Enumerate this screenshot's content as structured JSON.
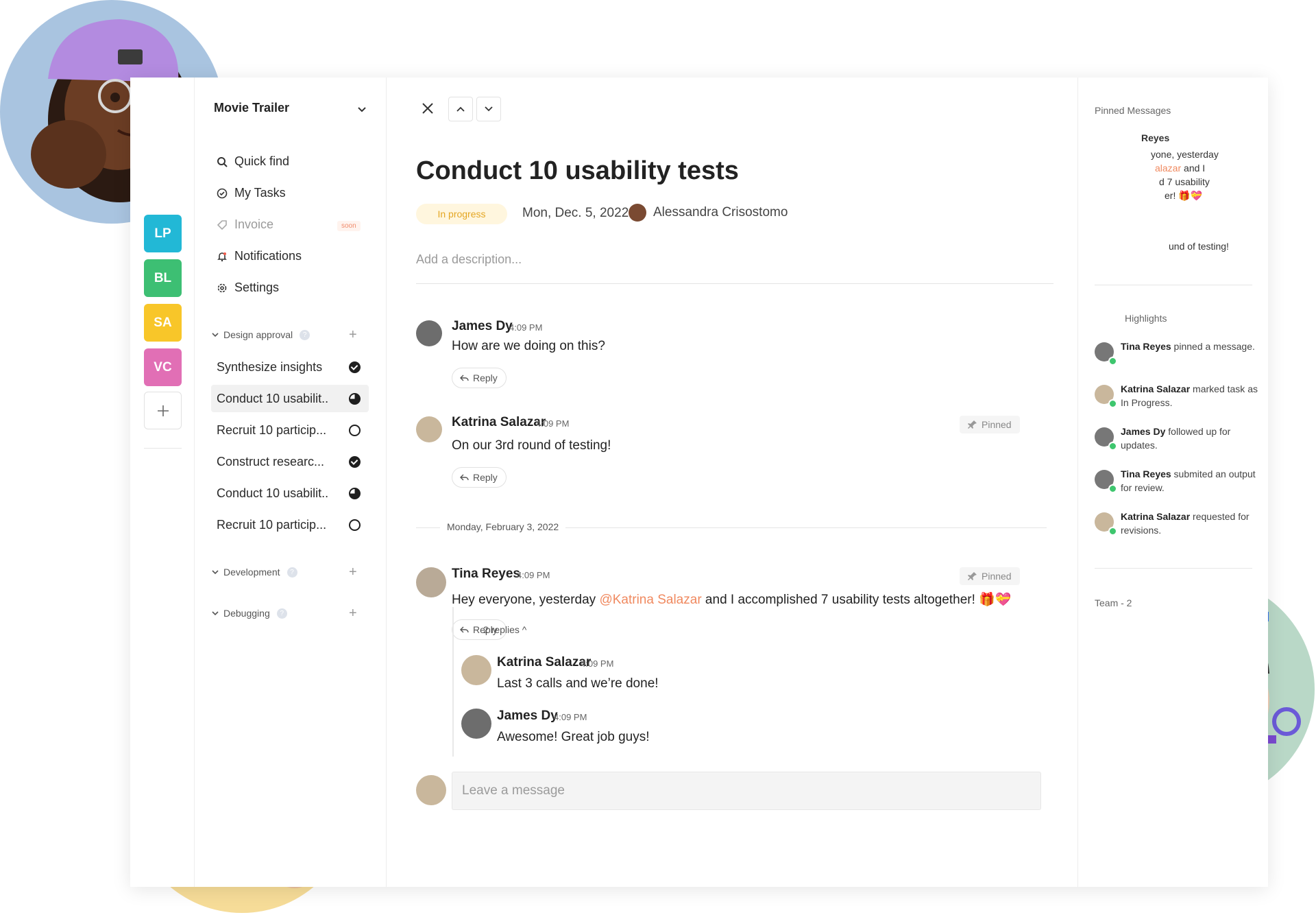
{
  "sidebar": {
    "project_title": "Movie Trailer",
    "workspaces": [
      {
        "label": "LP",
        "color": "#22b8d6"
      },
      {
        "label": "BL",
        "color": "#3dbf73"
      },
      {
        "label": "SA",
        "color": "#f8c629"
      },
      {
        "label": "VC",
        "color": "#e16fb5"
      }
    ],
    "nav": [
      {
        "label": "Quick find",
        "icon": "search-icon"
      },
      {
        "label": "My Tasks",
        "icon": "check-circle-icon"
      },
      {
        "label": "Invoice",
        "icon": "tag-icon",
        "badge": "soon"
      },
      {
        "label": "Notifications",
        "icon": "bell-icon"
      },
      {
        "label": "Settings",
        "icon": "gear-icon"
      }
    ],
    "groups": [
      {
        "label": "Design approval",
        "tasks": [
          {
            "label": "Synthesize insights",
            "status": "done"
          },
          {
            "label": "Conduct 10 usabilit..",
            "status": "in-progress",
            "active": true
          },
          {
            "label": "Recruit 10 particip...",
            "status": "todo"
          },
          {
            "label": "Construct researc...",
            "status": "done"
          },
          {
            "label": "Conduct 10 usabilit..",
            "status": "in-progress"
          },
          {
            "label": "Recruit 10 particip...",
            "status": "todo"
          }
        ]
      },
      {
        "label": "Development",
        "tasks": []
      },
      {
        "label": "Debugging",
        "tasks": []
      }
    ]
  },
  "task": {
    "title": "Conduct 10 usability tests",
    "status": "In progress",
    "date": "Mon, Dec. 5, 2022",
    "assignee": "Alessandra Crisostomo",
    "description_placeholder": "Add a description..."
  },
  "messages": [
    {
      "name": "James Dy",
      "time": "4:09 PM",
      "text": "How are we doing on this?",
      "reply": "Reply"
    },
    {
      "name": "Katrina Salazar",
      "time": "4:09 PM",
      "text": "On our 3rd round of testing!",
      "reply": "Reply",
      "pinned": "Pinned"
    },
    {
      "name": "Tina Reyes",
      "time": "4:09 PM",
      "text_before": "Hey everyone, yesterday ",
      "mention": "@Katrina Salazar",
      "text_after": " and I accomplished 7 usability tests altogether! 🎁💝",
      "reply": "Reply",
      "pinned": "Pinned",
      "replies": "2 replies ^",
      "thread": [
        {
          "name": "Katrina Salazar",
          "time": "4:09 PM",
          "text": "Last 3 calls and we’re done!"
        },
        {
          "name": "James Dy",
          "time": "4:09 PM",
          "text": "Awesome! Great job guys!"
        }
      ]
    }
  ],
  "day_divider": "Monday, February 3, 2022",
  "composer_placeholder": "Leave a message",
  "right_panel": {
    "pinned_title": "Pinned Messages",
    "pinned_1_name": "Reyes",
    "pinned_1_line1": "yone, yesterday",
    "pinned_1_line2_a": "alazar",
    "pinned_1_line2_b": " and I",
    "pinned_1_line3": "d 7 usability",
    "pinned_1_line4": "er! 🎁💝",
    "pinned_2_text": "und of testing!",
    "highlights_title": "Highlights",
    "highlights": [
      {
        "name": "Tina Reyes",
        "action": " pinned a message."
      },
      {
        "name": "Katrina Salazar",
        "action": " marked task as In Progress."
      },
      {
        "name": "James Dy",
        "action": " followed up for updates."
      },
      {
        "name": "Tina Reyes",
        "action": " submited an output for review."
      },
      {
        "name": "Katrina Salazar",
        "action": " requested for revisions."
      }
    ],
    "team_title": "Team - 2"
  }
}
